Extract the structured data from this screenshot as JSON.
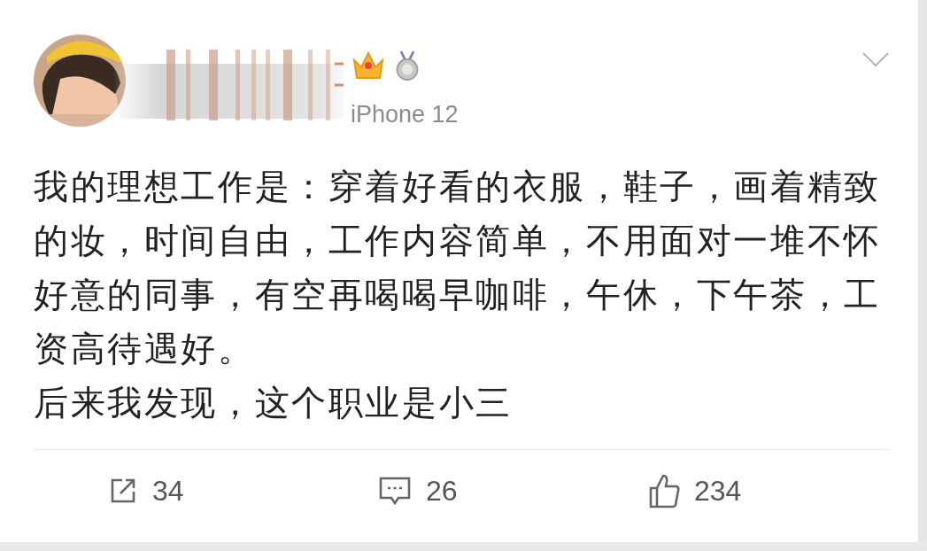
{
  "post": {
    "avatar": {
      "kind": "picture"
    },
    "device": "iPhone 12",
    "paragraphs": [
      "我的理想工作是：穿着好看的衣服，鞋子，画着精致的妆，时间自由，工作内容简单，不用面对一堆不怀好意的同事，有空再喝喝早咖啡，午休，下午茶，工资高待遇好。",
      "后来我发现，这个职业是小三"
    ],
    "actions": [
      {
        "kind": "repost",
        "count": "34"
      },
      {
        "kind": "comment",
        "count": "26"
      },
      {
        "kind": "like",
        "count": "234"
      }
    ]
  }
}
